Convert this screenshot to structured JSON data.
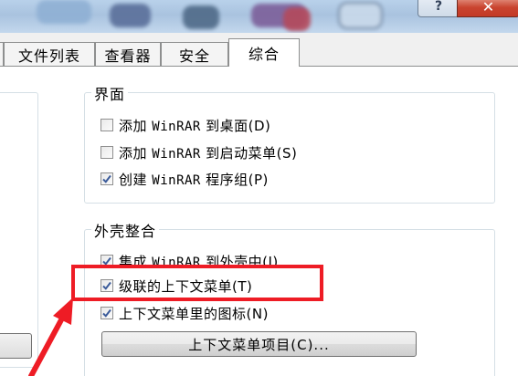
{
  "window": {
    "help_label": "?",
    "close_label": "✕"
  },
  "tabs": [
    {
      "label": "文件列表",
      "active": false
    },
    {
      "label": "查看器",
      "active": false
    },
    {
      "label": "安全",
      "active": false
    },
    {
      "label": "综合",
      "active": true
    }
  ],
  "interface_group": {
    "title": "界面",
    "items": [
      {
        "label": "添加 WinRAR 到桌面(D)",
        "checked": false
      },
      {
        "label": "添加 WinRAR 到启动菜单(S)",
        "checked": false
      },
      {
        "label": "创建 WinRAR 程序组(P)",
        "checked": true
      }
    ]
  },
  "shell_group": {
    "title": "外壳整合",
    "items": [
      {
        "label": "集成 WinRAR 到外壳中(I)",
        "checked": true
      },
      {
        "label": "级联的上下文菜单(T)",
        "checked": true
      },
      {
        "label": "上下文菜单里的图标(N)",
        "checked": true
      }
    ],
    "button_label": "上下文菜单项目(C)..."
  },
  "annotation": {
    "highlight_color": "#ee1c25"
  }
}
